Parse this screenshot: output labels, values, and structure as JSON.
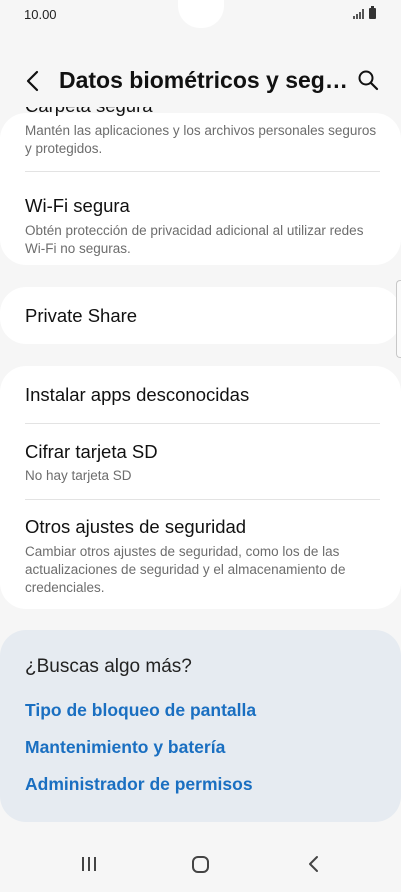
{
  "status_bar": {
    "time": "10.00"
  },
  "header": {
    "title": "Datos biométricos y segu…"
  },
  "sections": {
    "carpeta": {
      "title": "Carpeta segura",
      "subtitle": "Mantén las aplicaciones y los archivos personales seguros y protegidos."
    },
    "wifi": {
      "title": "Wi-Fi segura",
      "subtitle": "Obtén protección de privacidad adicional al utilizar redes Wi-Fi no seguras."
    },
    "private_share": {
      "title": "Private Share"
    },
    "instalar": {
      "title": "Instalar apps desconocidas"
    },
    "cifrar": {
      "title": "Cifrar tarjeta SD",
      "subtitle": "No hay tarjeta SD"
    },
    "otros": {
      "title": "Otros ajustes de seguridad",
      "subtitle": "Cambiar otros ajustes de seguridad, como los de las actualizaciones de seguridad y el almacenamiento de credenciales."
    }
  },
  "suggestions": {
    "title": "¿Buscas algo más?",
    "links": [
      "Tipo de bloqueo de pantalla",
      "Mantenimiento y batería",
      "Administrador de permisos"
    ]
  },
  "colors": {
    "link": "#1a6fc1",
    "card": "#ffffff",
    "background": "#f6f6f6",
    "suggestion_card": "#e6ebf1"
  },
  "icons": [
    "back-arrow-icon",
    "search-icon",
    "signal-icon",
    "battery-icon",
    "recents-icon",
    "home-icon",
    "nav-back-icon"
  ]
}
